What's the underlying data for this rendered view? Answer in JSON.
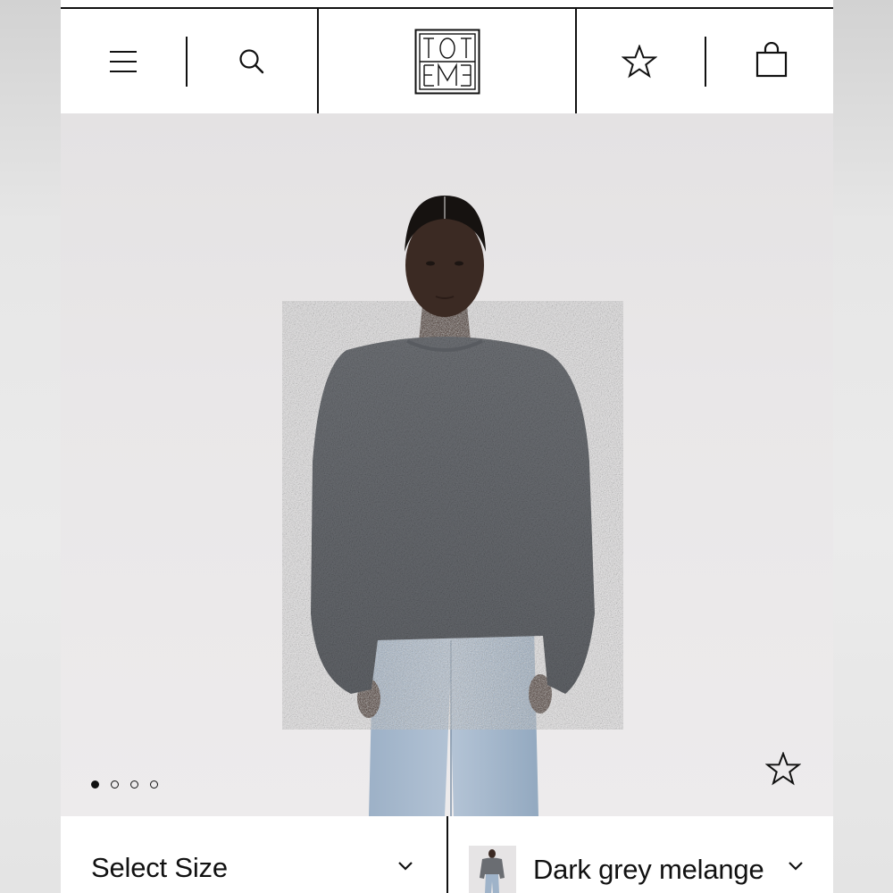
{
  "header": {
    "menu_icon": "menu-icon",
    "search_icon": "search-icon",
    "brand_logo": "toteme-monogram-logo",
    "wishlist_icon": "star-icon",
    "bag_icon": "shopping-bag-icon"
  },
  "gallery": {
    "image_count": 4,
    "active_index": 0,
    "favorite_icon": "star-icon"
  },
  "product_options": {
    "size_label": "Select Size",
    "color_label": "Dark grey melange",
    "dropdown_icon": "chevron-down-icon"
  },
  "colors": {
    "text": "#111111",
    "background": "#ffffff",
    "hero_background": "#e8e6e7",
    "sweater": "#6a6d72",
    "jeans": "#9fb3c9"
  }
}
